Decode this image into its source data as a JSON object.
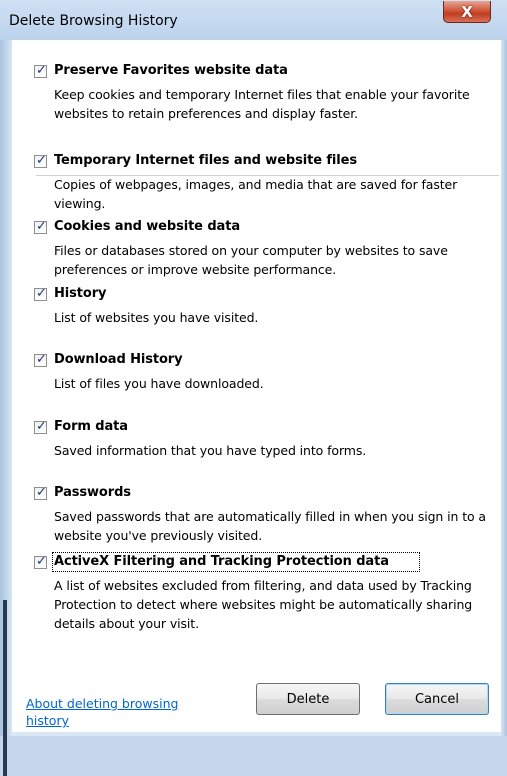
{
  "window": {
    "title": "Delete Browsing History",
    "close_glyph": "X"
  },
  "options": [
    {
      "title": "Preserve Favorites website data",
      "checked": true,
      "description": "Keep cookies and temporary Internet files that enable your favorite websites to retain preferences and display faster."
    },
    {
      "title": "Temporary Internet files and website files",
      "checked": true,
      "description": "Copies of webpages, images, and media that are saved for faster viewing."
    },
    {
      "title": "Cookies and website data",
      "checked": true,
      "description": "Files or databases stored on your computer by websites to save preferences or improve website performance."
    },
    {
      "title": "History",
      "checked": true,
      "description": "List of websites you have visited."
    },
    {
      "title": "Download History",
      "checked": true,
      "description": "List of files you have downloaded."
    },
    {
      "title": "Form data",
      "checked": true,
      "description": "Saved information that you have typed into forms."
    },
    {
      "title": "Passwords",
      "checked": true,
      "description": "Saved passwords that are automatically filled in when you sign in to a website you've previously visited."
    },
    {
      "title": "ActiveX Filtering and Tracking Protection data",
      "checked": true,
      "description": "A list of websites excluded from filtering, and data used by Tracking Protection to detect where websites might be automatically sharing details about your visit."
    }
  ],
  "footer": {
    "link": "About deleting browsing history",
    "delete_label": "Delete",
    "cancel_label": "Cancel"
  }
}
